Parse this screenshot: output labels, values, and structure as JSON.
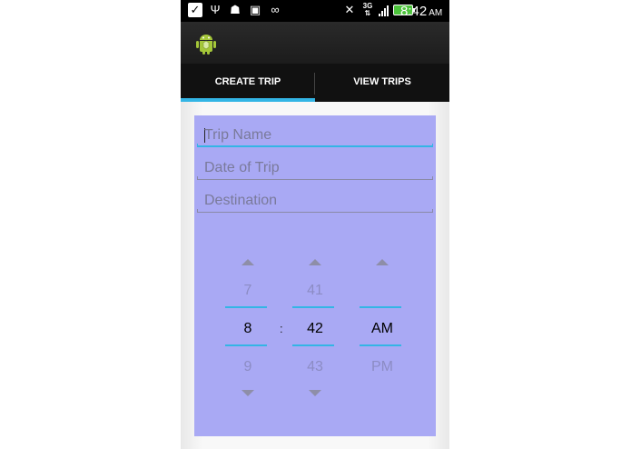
{
  "status_bar": {
    "time": "8:42",
    "ampm": "AM",
    "network": "3G",
    "icons_left": [
      "check-icon",
      "usb-icon",
      "android-debug-icon",
      "image-icon",
      "voicemail-icon"
    ],
    "icons_right": [
      "data-sync-icon",
      "3g-icon",
      "signal-icon",
      "battery-icon"
    ]
  },
  "action_bar": {
    "app_icon": "android-app-icon"
  },
  "tabs": [
    {
      "label": "CREATE TRIP",
      "active": true
    },
    {
      "label": "VIEW TRIPS",
      "active": false
    }
  ],
  "form": {
    "trip_name": {
      "placeholder": "Trip Name",
      "value": ""
    },
    "date_of_trip": {
      "placeholder": "Date of Trip",
      "value": ""
    },
    "destination": {
      "placeholder": "Destination",
      "value": ""
    }
  },
  "time_picker": {
    "hour": {
      "prev": "7",
      "current": "8",
      "next": "9"
    },
    "separator": ":",
    "minute": {
      "prev": "41",
      "current": "42",
      "next": "43"
    },
    "ampm": {
      "prev": "",
      "current": "AM",
      "next": "PM"
    }
  },
  "colors": {
    "accent": "#33b5e5",
    "panel": "#a9a9f4",
    "status_bar": "#000000",
    "tab_bar": "#111111"
  }
}
